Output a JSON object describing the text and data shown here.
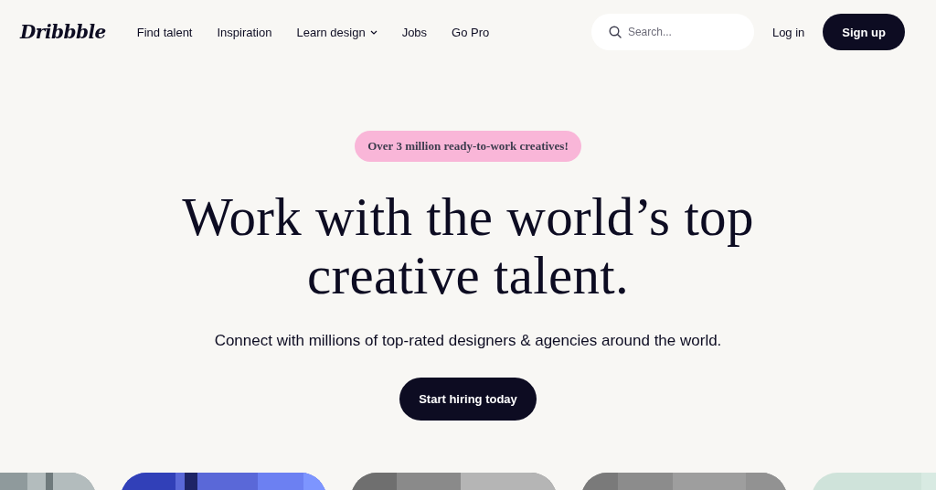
{
  "logo": "Dribbble",
  "nav": [
    {
      "label": "Find talent",
      "dropdown": false
    },
    {
      "label": "Inspiration",
      "dropdown": false
    },
    {
      "label": "Learn design",
      "dropdown": true
    },
    {
      "label": "Jobs",
      "dropdown": false
    },
    {
      "label": "Go Pro",
      "dropdown": false
    }
  ],
  "search": {
    "placeholder": "Search..."
  },
  "login": "Log in",
  "signup": "Sign up",
  "badge": "Over 3 million ready-to-work creatives!",
  "headline": "Work with the world’s top creative talent.",
  "subheadline": "Connect with millions of top-rated designers & agencies around the world.",
  "cta": "Start hiring today"
}
